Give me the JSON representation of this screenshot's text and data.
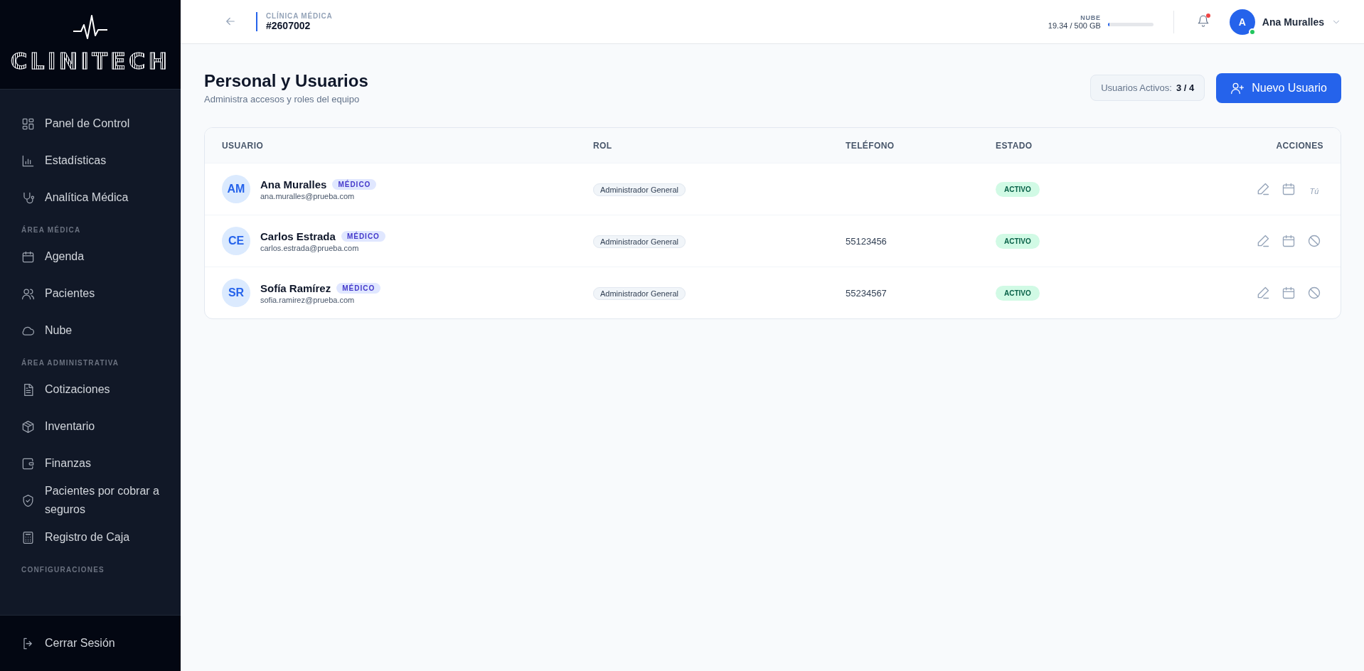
{
  "sidebar": {
    "logo": "CLINITECH",
    "items": [
      {
        "kind": "item",
        "label": "Panel de Control"
      },
      {
        "kind": "item",
        "label": "Estadísticas"
      },
      {
        "kind": "item",
        "label": "Analítica Médica"
      },
      {
        "kind": "section",
        "label": "ÁREA MÉDICA"
      },
      {
        "kind": "item",
        "label": "Agenda"
      },
      {
        "kind": "item",
        "label": "Pacientes"
      },
      {
        "kind": "item",
        "label": "Nube"
      },
      {
        "kind": "section",
        "label": "ÁREA ADMINISTRATIVA"
      },
      {
        "kind": "item",
        "label": "Cotizaciones"
      },
      {
        "kind": "item",
        "label": "Inventario"
      },
      {
        "kind": "item",
        "label": "Finanzas"
      },
      {
        "kind": "item",
        "label": "Pacientes por cobrar a seguros"
      },
      {
        "kind": "item",
        "label": "Registro de Caja"
      },
      {
        "kind": "section",
        "label": "CONFIGURACIONES"
      }
    ],
    "logout": "Cerrar Sesión"
  },
  "header": {
    "clinic_label": "CLÍNICA MÉDICA",
    "clinic_id": "#2607002",
    "cloud": {
      "label": "NUBE",
      "usage": "19.34 / 500 GB",
      "level": 0.04
    },
    "notification_unread": true,
    "user_initial": "A",
    "user_online": true,
    "user_name": "Ana Muralles"
  },
  "page": {
    "title": "Personal y Usuarios",
    "subtitle": "Administra accesos y roles del equipo",
    "active_label": "Usuarios Activos:",
    "active_count": "3 / 4",
    "new_button": "Nuevo Usuario"
  },
  "table": {
    "columns": [
      "USUARIO",
      "ROL",
      "TELÉFONO",
      "ESTADO",
      "ACCIONES"
    ],
    "rows": [
      {
        "initials": "AM",
        "name": "Ana Muralles",
        "tag": "MÉDICO",
        "email": "ana.muralles@prueba.com",
        "role": "Administrador General",
        "status": "ACTIVO",
        "self_label": "Tú"
      },
      {
        "initials": "CE",
        "name": "Carlos Estrada",
        "tag": "MÉDICO",
        "email": "carlos.estrada@prueba.com",
        "role": "Administrador General",
        "phone": "55123456",
        "status": "ACTIVO"
      },
      {
        "initials": "SR",
        "name": "Sofía Ramírez",
        "tag": "MÉDICO",
        "email": "sofia.ramirez@prueba.com",
        "role": "Administrador General",
        "phone": "55234567",
        "status": "ACTIVO"
      }
    ]
  }
}
